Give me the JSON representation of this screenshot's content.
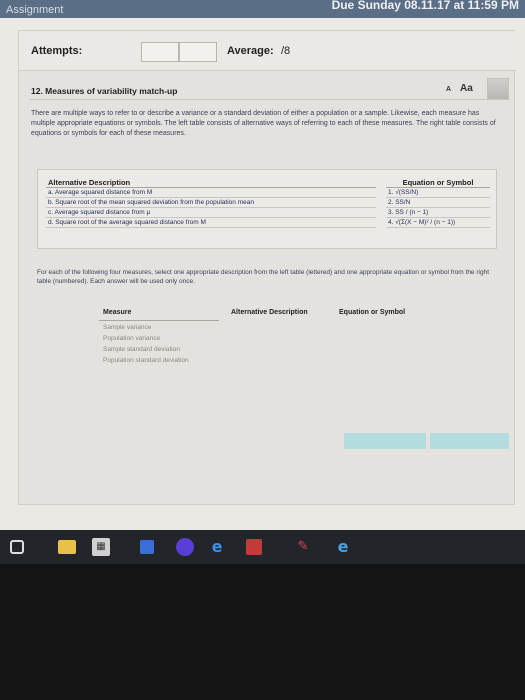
{
  "topbar": {
    "tab_label": "Assignment",
    "due_text": "Due Sunday 08.11.17 at 11:59 PM"
  },
  "header": {
    "attempts_label": "Attempts:",
    "average_label": "Average:",
    "average_value": "/8"
  },
  "question": {
    "title": "12.  Measures of variability match-up",
    "font_smaller": "A",
    "font_larger": "Aa",
    "intro": "There are multiple ways to refer to or describe a variance or a standard deviation of either a population or a sample. Likewise, each measure has multiple appropriate equations or symbols. The left table consists of alternative ways of referring to each of these measures. The right table consists of equations or symbols for each of these measures."
  },
  "alternative_table": {
    "header": "Alternative Description",
    "rows": [
      "a. Average squared distance from M",
      "b. Square root of the mean squared deviation from the population mean",
      "c. Average squared distance from μ",
      "d. Square root of the average squared distance from M"
    ]
  },
  "equation_table": {
    "header": "Equation or Symbol",
    "rows": [
      "1. √(SS/N)",
      "2. SS/N",
      "3. SS / (n − 1)",
      "4. √(Σ(X − M)² / (n − 1))"
    ]
  },
  "instructions": "For each of the following four measures, select one appropriate description from the left table (lettered) and one appropriate equation or symbol from the right table (numbered). Each answer will be used only once.",
  "measure_table": {
    "headers": [
      "Measure",
      "Alternative Description",
      "Equation or Symbol"
    ],
    "rows": [
      "Sample variance",
      "Population variance",
      "Sample standard deviation",
      "Population standard deviation"
    ]
  },
  "colors": {
    "accent_button": "#b3dcdf",
    "body_text": "#1f2a55"
  }
}
